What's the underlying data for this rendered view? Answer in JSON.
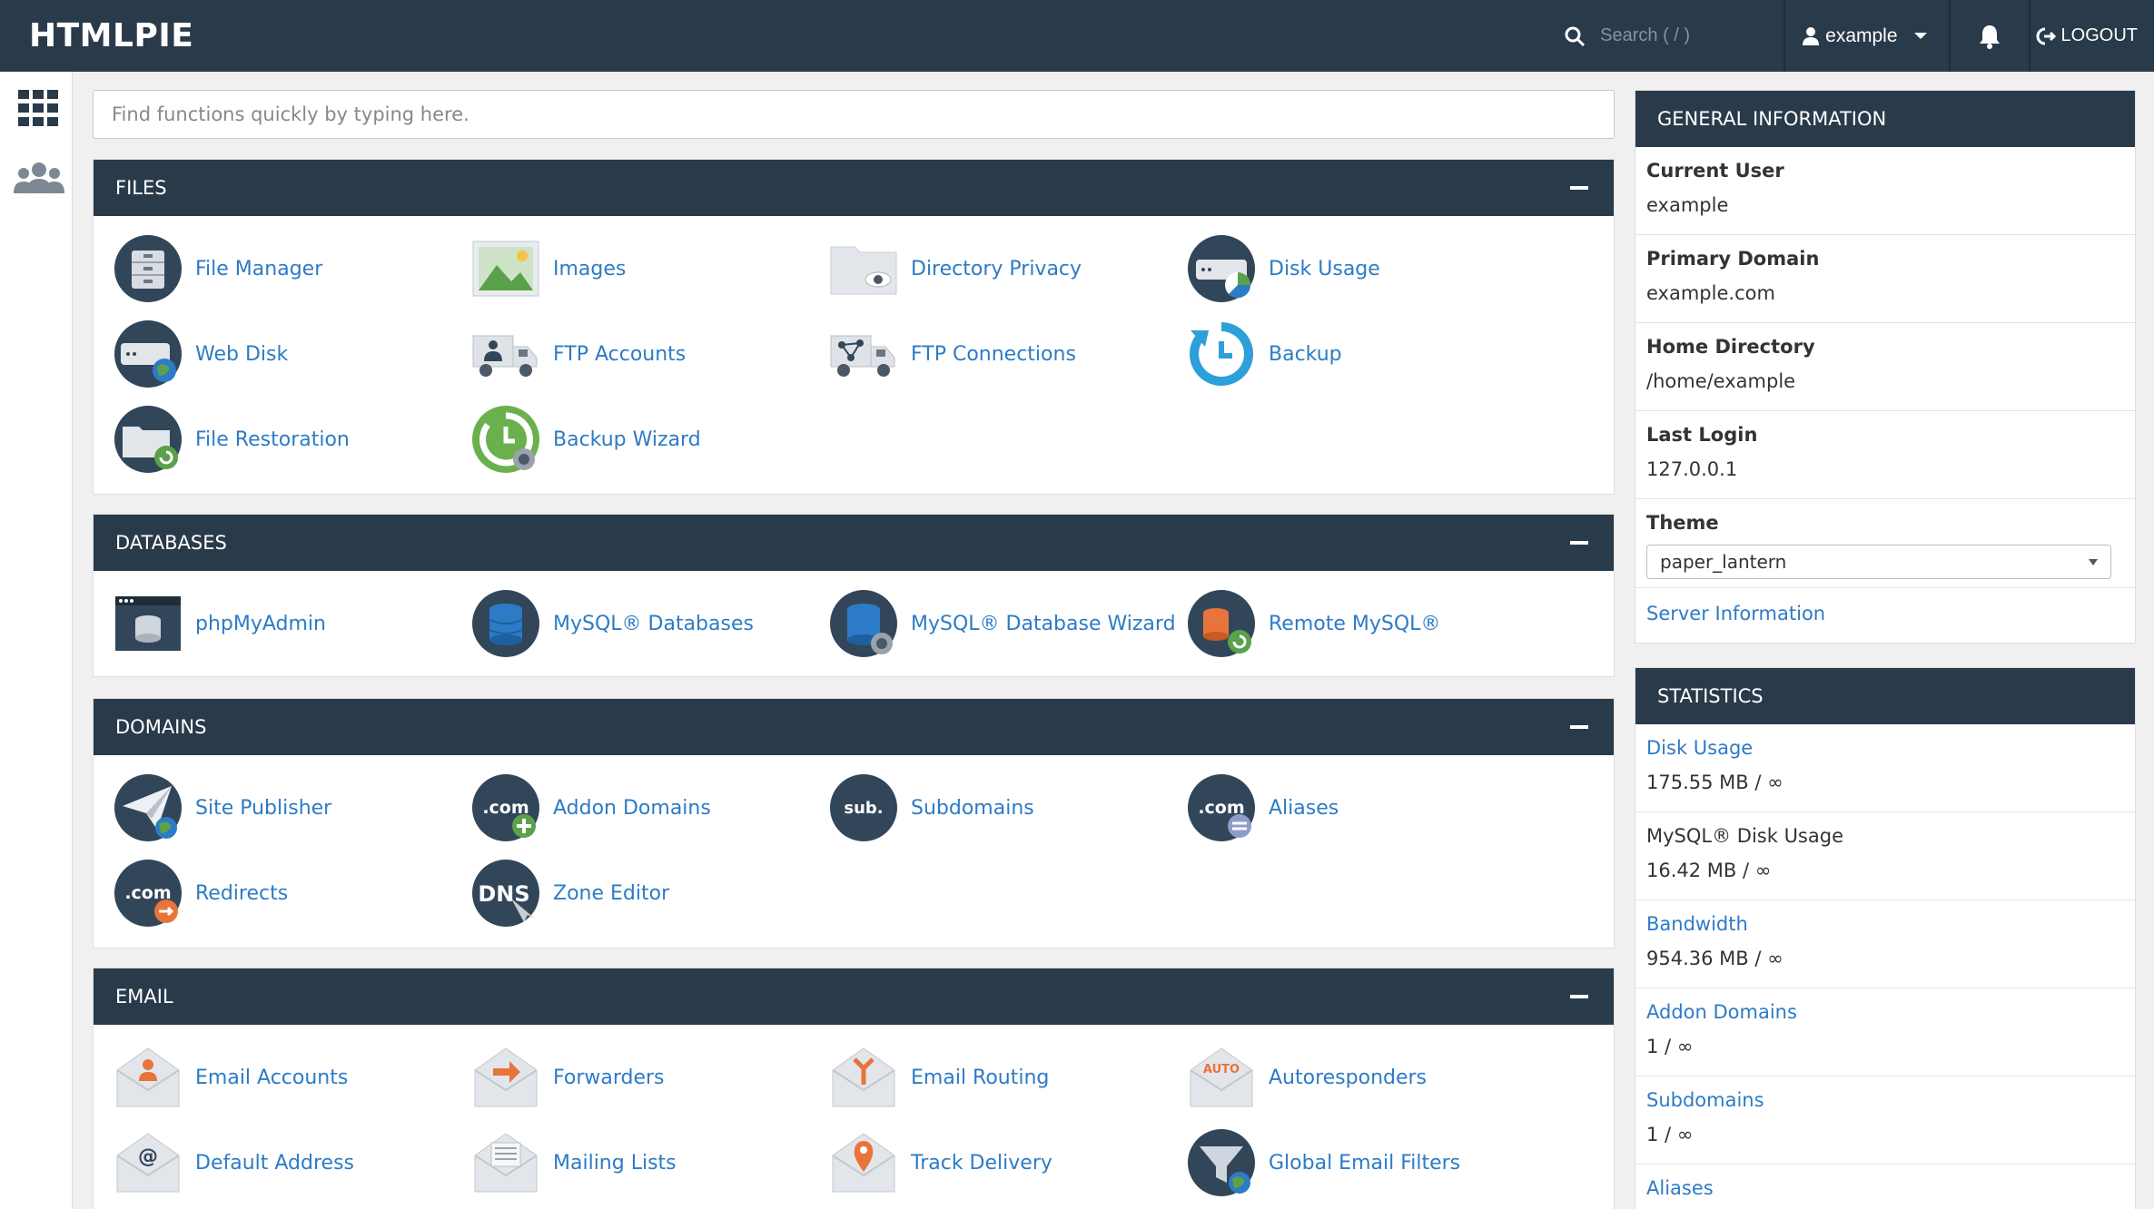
{
  "brand": "HTMLPIE",
  "topbar": {
    "search_placeholder": "Search ( / )",
    "username": "example",
    "logout_label": "LOGOUT"
  },
  "quick_search_placeholder": "Find functions quickly by typing here.",
  "sections": {
    "files": {
      "title": "FILES",
      "items": [
        "File Manager",
        "Images",
        "Directory Privacy",
        "Disk Usage",
        "Web Disk",
        "FTP Accounts",
        "FTP Connections",
        "Backup",
        "File Restoration",
        "Backup Wizard"
      ]
    },
    "databases": {
      "title": "DATABASES",
      "items": [
        "phpMyAdmin",
        "MySQL® Databases",
        "MySQL® Database Wizard",
        "Remote MySQL®"
      ]
    },
    "domains": {
      "title": "DOMAINS",
      "items": [
        "Site Publisher",
        "Addon Domains",
        "Subdomains",
        "Aliases",
        "Redirects",
        "Zone Editor"
      ]
    },
    "email": {
      "title": "EMAIL",
      "items": [
        "Email Accounts",
        "Forwarders",
        "Email Routing",
        "Autoresponders",
        "Default Address",
        "Mailing Lists",
        "Track Delivery",
        "Global Email Filters"
      ]
    }
  },
  "general_info": {
    "title": "GENERAL INFORMATION",
    "current_user_label": "Current User",
    "current_user": "example",
    "primary_domain_label": "Primary Domain",
    "primary_domain": "example.com",
    "home_dir_label": "Home Directory",
    "home_dir": "/home/example",
    "last_login_label": "Last Login",
    "last_login": "127.0.0.1",
    "theme_label": "Theme",
    "theme_value": "paper_lantern",
    "server_info_link": "Server Information"
  },
  "statistics": {
    "title": "STATISTICS",
    "rows": [
      {
        "label": "Disk Usage",
        "value": "175.55 MB / ∞",
        "link": true
      },
      {
        "label": "MySQL® Disk Usage",
        "value": "16.42 MB / ∞",
        "link": false
      },
      {
        "label": "Bandwidth",
        "value": "954.36 MB / ∞",
        "link": true
      },
      {
        "label": "Addon Domains",
        "value": "1 / ∞",
        "link": true
      },
      {
        "label": "Subdomains",
        "value": "1 / ∞",
        "link": true
      },
      {
        "label": "Aliases",
        "value": "",
        "link": true
      }
    ]
  },
  "colors": {
    "header_bg": "#293a4a",
    "link": "#2d7bc6",
    "page_bg": "#f0f0f0"
  }
}
